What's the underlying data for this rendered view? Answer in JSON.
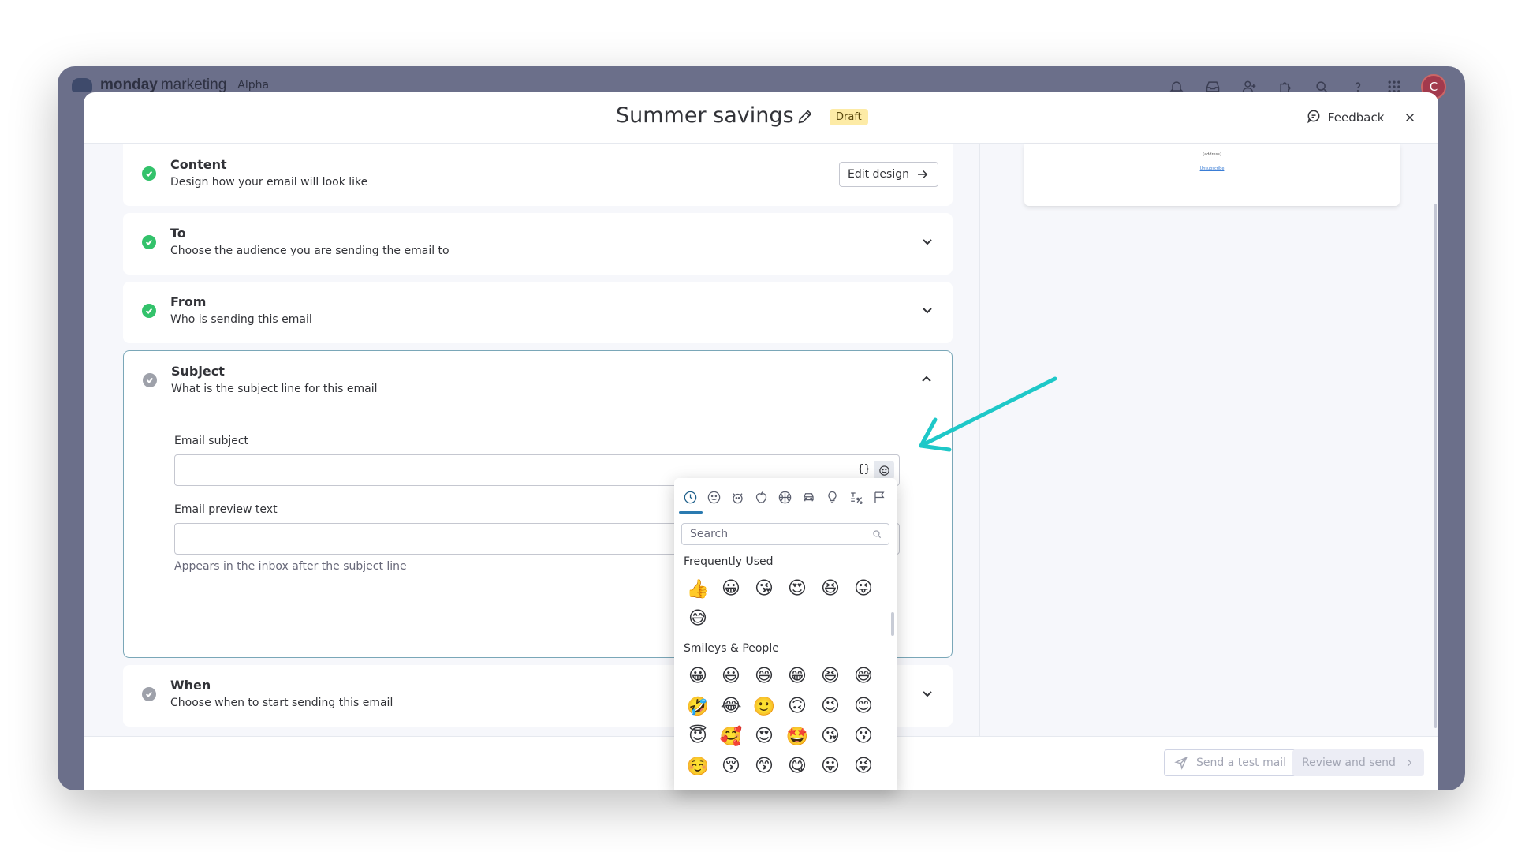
{
  "app": {
    "logo_text": "monday",
    "logo_text2": "marketing",
    "badge": "Alpha",
    "avatar_initial": "C"
  },
  "header": {
    "title": "Summer savings",
    "status_badge": "Draft",
    "feedback_label": "Feedback"
  },
  "steps": {
    "content": {
      "title": "Content",
      "desc": "Design how your email will look like",
      "button": "Edit design"
    },
    "to": {
      "title": "To",
      "desc": "Choose the audience you are sending the email to"
    },
    "from": {
      "title": "From",
      "desc": "Who is sending this email"
    },
    "subject": {
      "title": "Subject",
      "desc": "What is the subject line for this email",
      "email_subject_label": "Email subject",
      "email_subject_value": "",
      "personalize_icon": "{}",
      "preview_label": "Email preview text",
      "preview_value": "",
      "preview_helper": "Appears in the inbox after the subject line"
    },
    "when": {
      "title": "When",
      "desc": "Choose when to start sending this email"
    }
  },
  "preview": {
    "line1": "[address]",
    "line2": "Unsubscribe"
  },
  "footer": {
    "send_test": "Send a test mail",
    "review_send": "Review and send"
  },
  "emoji_picker": {
    "search_placeholder": "Search",
    "frequent_title": "Frequently Used",
    "frequent": [
      "👍",
      "😀",
      "😘",
      "😍",
      "😆",
      "😜",
      "😅"
    ],
    "smileys_title": "Smileys & People",
    "smileys": [
      "😀",
      "😃",
      "😄",
      "😁",
      "😆",
      "😅",
      "🤣",
      "😂",
      "🙂",
      "🙃",
      "😉",
      "😊",
      "😇",
      "🥰",
      "😍",
      "🤩",
      "😘",
      "😗",
      "☺️",
      "😚",
      "😙",
      "😋",
      "😛",
      "😜"
    ]
  },
  "colors": {
    "accent_teal": "#1ec8c8",
    "check_done": "#33c26b",
    "check_pending": "#9ea1aa",
    "draft_badge": "#fdeba6"
  }
}
